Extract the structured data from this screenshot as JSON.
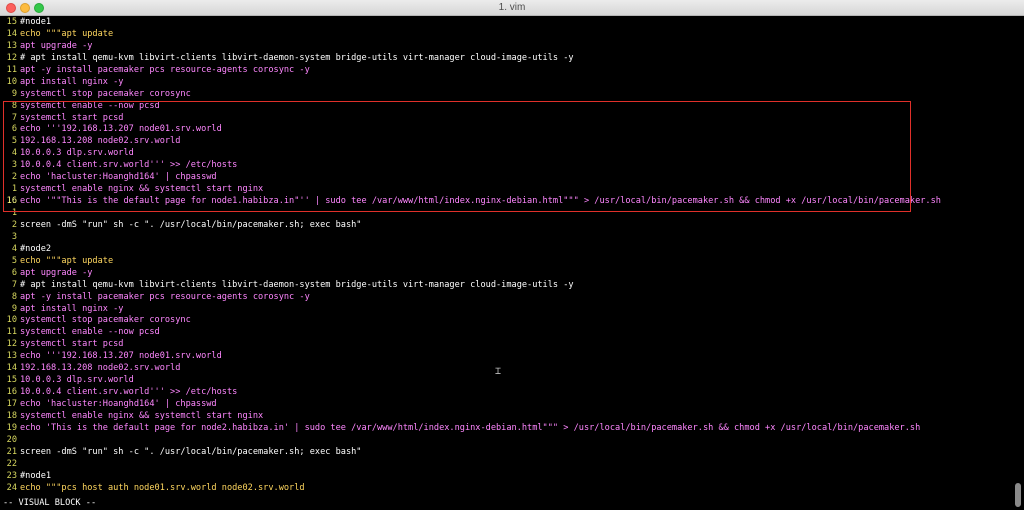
{
  "window": {
    "title": "1. vim"
  },
  "statusbar": {
    "mode": "-- VISUAL BLOCK --"
  },
  "cursor_icon": "text-cursor-icon",
  "lines": [
    {
      "num": "15",
      "text": "#node1"
    },
    {
      "num": "14",
      "text": "echo \"\"\"apt update"
    },
    {
      "num": "13",
      "text": "apt upgrade -y"
    },
    {
      "num": "12",
      "text": "# apt install qemu-kvm libvirt-clients libvirt-daemon-system bridge-utils virt-manager cloud-image-utils -y"
    },
    {
      "num": "11",
      "text": "apt -y install pacemaker pcs resource-agents corosync -y"
    },
    {
      "num": "10",
      "text": "apt install nginx -y"
    },
    {
      "num": "9",
      "text": "systemctl stop pacemaker corosync"
    },
    {
      "num": "8",
      "text": "systemctl enable --now pcsd"
    },
    {
      "num": "7",
      "text": "systemctl start pcsd"
    },
    {
      "num": "6",
      "text": "echo '''192.168.13.207 node01.srv.world"
    },
    {
      "num": "5",
      "text": "192.168.13.208 node02.srv.world"
    },
    {
      "num": "4",
      "text": "10.0.0.3 dlp.srv.world"
    },
    {
      "num": "3",
      "text": "10.0.0.4 client.srv.world''' >> /etc/hosts"
    },
    {
      "num": "2",
      "text": "echo 'hacluster:Hoanghd164' | chpasswd"
    },
    {
      "num": "1",
      "text": "systemctl enable nginx && systemctl start nginx"
    },
    {
      "num": "16",
      "text": "echo '\"\"This is the default page for node1.habibza.in\"'' | sudo tee /var/www/html/index.nginx-debian.html\"\"\" > /usr/local/bin/pacemaker.sh && chmod +x /usr/local/bin/pacemaker.sh"
    },
    {
      "num": "1",
      "text": ""
    },
    {
      "num": "2",
      "text": "screen -dmS \"run\" sh -c \". /usr/local/bin/pacemaker.sh; exec bash\""
    },
    {
      "num": "3",
      "text": ""
    },
    {
      "num": "4",
      "text": "#node2"
    },
    {
      "num": "5",
      "text": "echo \"\"\"apt update"
    },
    {
      "num": "6",
      "text": "apt upgrade -y"
    },
    {
      "num": "7",
      "text": "# apt install qemu-kvm libvirt-clients libvirt-daemon-system bridge-utils virt-manager cloud-image-utils -y"
    },
    {
      "num": "8",
      "text": "apt -y install pacemaker pcs resource-agents corosync -y"
    },
    {
      "num": "9",
      "text": "apt install nginx -y"
    },
    {
      "num": "10",
      "text": "systemctl stop pacemaker corosync"
    },
    {
      "num": "11",
      "text": "systemctl enable --now pcsd"
    },
    {
      "num": "12",
      "text": "systemctl start pcsd"
    },
    {
      "num": "13",
      "text": "echo '''192.168.13.207 node01.srv.world"
    },
    {
      "num": "14",
      "text": "192.168.13.208 node02.srv.world"
    },
    {
      "num": "15",
      "text": "10.0.0.3 dlp.srv.world"
    },
    {
      "num": "16",
      "text": "10.0.0.4 client.srv.world''' >> /etc/hosts"
    },
    {
      "num": "17",
      "text": "echo 'hacluster:Hoanghd164' | chpasswd"
    },
    {
      "num": "18",
      "text": "systemctl enable nginx && systemctl start nginx"
    },
    {
      "num": "19",
      "text": "echo 'This is the default page for node2.habibza.in' | sudo tee /var/www/html/index.nginx-debian.html\"\"\" > /usr/local/bin/pacemaker.sh && chmod +x /usr/local/bin/pacemaker.sh"
    },
    {
      "num": "20",
      "text": ""
    },
    {
      "num": "21",
      "text": "screen -dmS \"run\" sh -c \". /usr/local/bin/pacemaker.sh; exec bash\""
    },
    {
      "num": "22",
      "text": ""
    },
    {
      "num": "23",
      "text": "#node1"
    },
    {
      "num": "24",
      "text": "echo \"\"\"pcs host auth node01.srv.world node02.srv.world"
    }
  ],
  "colors": {
    "line_number": "#d7d75f",
    "string": "#ff87ff",
    "keyword": "#ffd75f",
    "selection_border": "#e0302a",
    "background": "#000000"
  }
}
